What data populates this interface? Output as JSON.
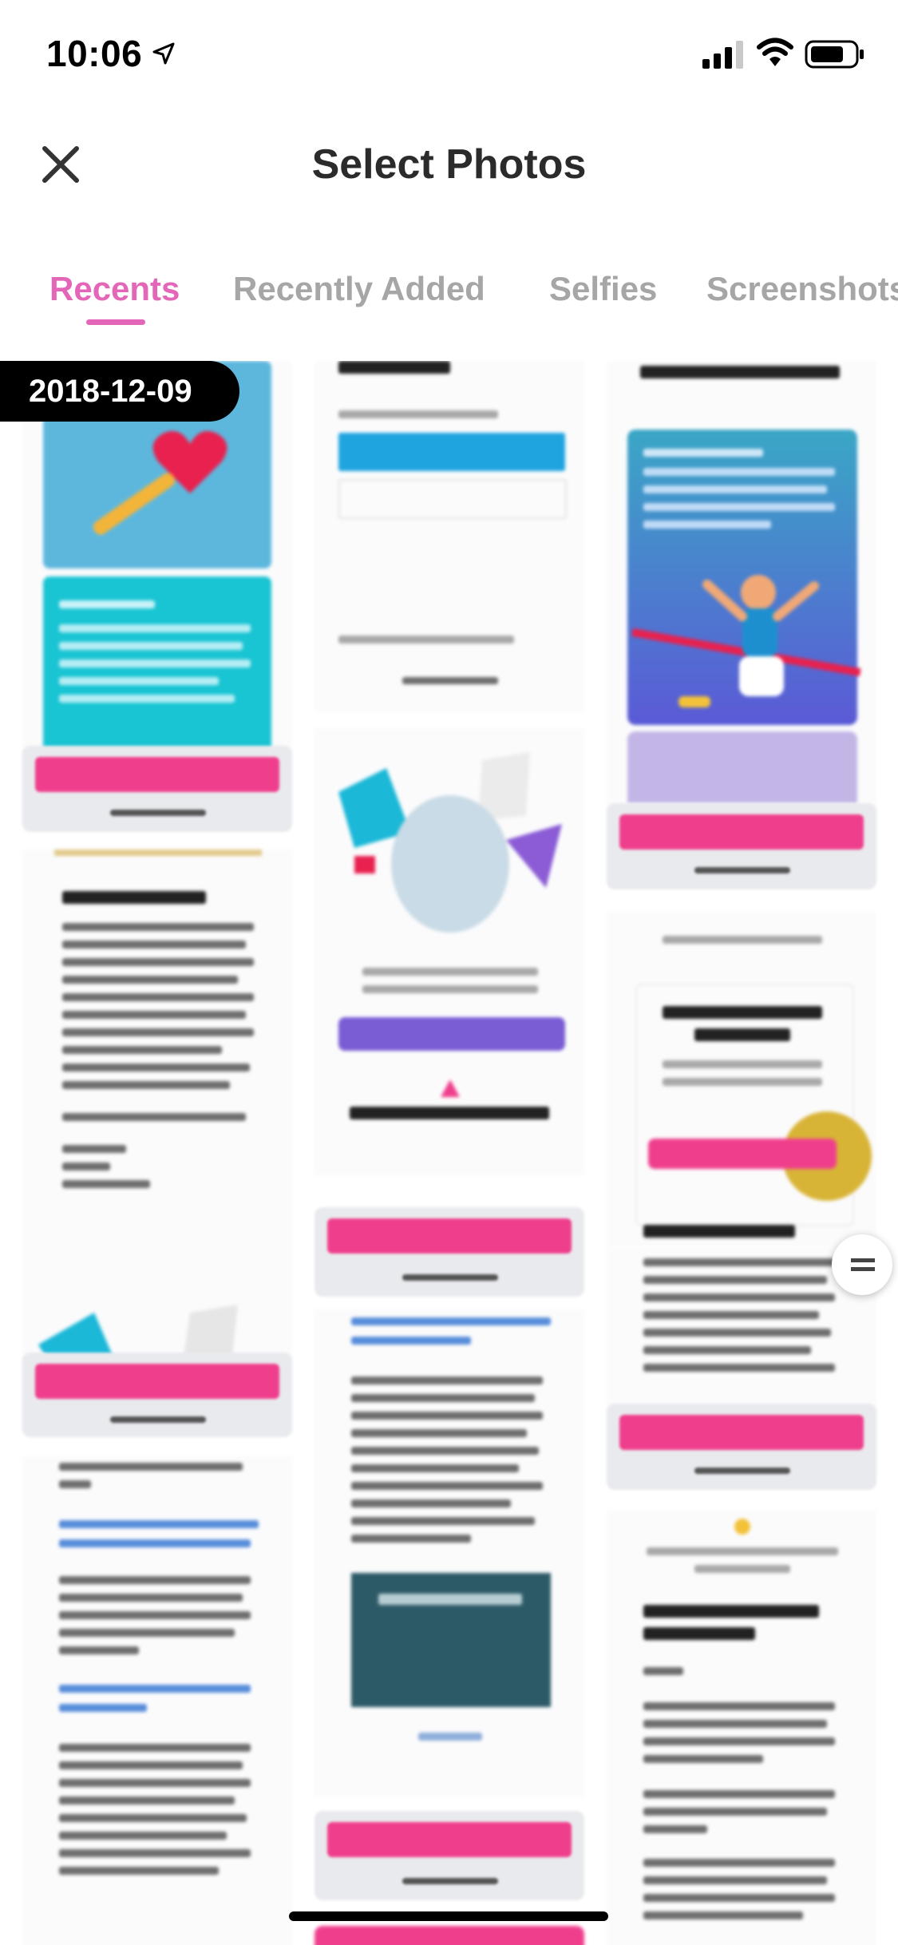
{
  "status_bar": {
    "time": "10:06"
  },
  "header": {
    "title": "Select Photos"
  },
  "tabs": [
    {
      "label": "Recents",
      "active": true
    },
    {
      "label": "Recently Added",
      "active": false
    },
    {
      "label": "Selfies",
      "active": false
    },
    {
      "label": "Screenshots",
      "active": false
    }
  ],
  "grid": {
    "date_label": "2018-12-09"
  },
  "colors": {
    "accent": "#e466b8",
    "cta_pink": "#ef3f8c",
    "teal": "#19c4d3",
    "sky": "#5db7dd",
    "purple": "#7a5cd4",
    "blue_button": "#20a4e0"
  }
}
